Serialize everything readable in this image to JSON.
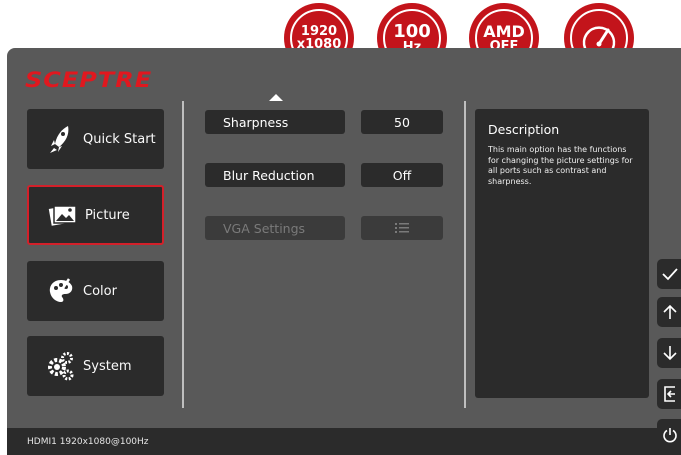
{
  "badges": {
    "resolution": {
      "line1": "1920",
      "line2": "x1080"
    },
    "refresh": {
      "line1": "100",
      "line2": "Hz"
    },
    "freesync": {
      "line1": "AMD",
      "line2": "OFF"
    },
    "speedometer_icon": "speedometer-icon"
  },
  "brand": {
    "logo_text": "SCEPTRE",
    "color": "#e0181f"
  },
  "menu": {
    "items": [
      {
        "label": "Quick Start",
        "icon": "rocket-icon"
      },
      {
        "label": "Picture",
        "icon": "picture-icon"
      },
      {
        "label": "Color",
        "icon": "palette-icon"
      },
      {
        "label": "System",
        "icon": "gears-icon"
      }
    ],
    "active": "Picture"
  },
  "settings": {
    "scroll_up_icon": "up-arrow-icon",
    "rows": [
      {
        "label": "Sharpness",
        "value": "50"
      },
      {
        "label": "Blur Reduction",
        "value": "Off"
      },
      {
        "label": "VGA Settings",
        "value_icon": "list-icon",
        "disabled": true
      }
    ]
  },
  "description": {
    "title": "Description",
    "text": "This main option has the functions for changing the picture settings for all ports such as contrast and sharpness."
  },
  "side_nav": [
    {
      "icon": "check-icon"
    },
    {
      "icon": "arrow-up-icon"
    },
    {
      "icon": "arrow-down-icon"
    },
    {
      "icon": "exit-icon"
    },
    {
      "icon": "power-icon"
    }
  ],
  "footer": {
    "status": "HDMI1 1920x1080@100Hz"
  },
  "colors": {
    "accent": "#c3141b",
    "panel": "#595959",
    "button": "#2b2b2b"
  }
}
